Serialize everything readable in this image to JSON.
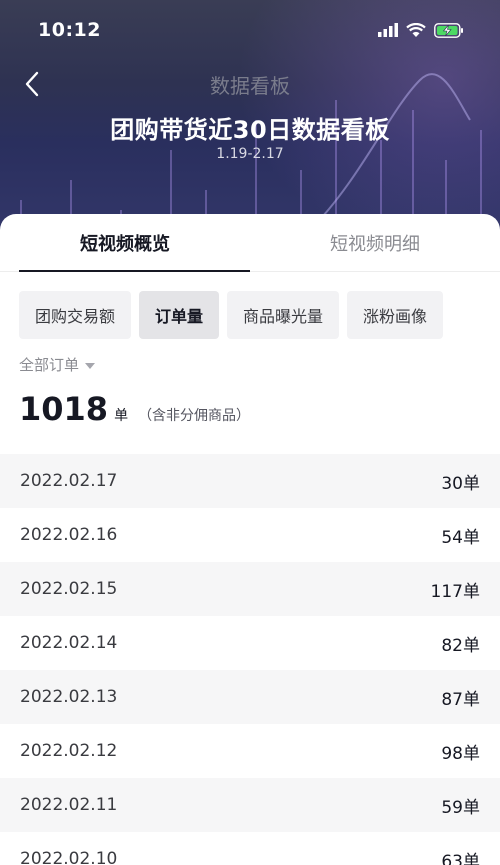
{
  "status_bar": {
    "time": "10:12"
  },
  "nav": {
    "title": "数据看板"
  },
  "hero": {
    "title": "团购带货近30日数据看板",
    "date_range": "1.19-2.17"
  },
  "tabs": [
    {
      "label": "短视频概览",
      "active": true
    },
    {
      "label": "短视频明细",
      "active": false
    }
  ],
  "chips": [
    {
      "label": "团购交易额",
      "active": false
    },
    {
      "label": "订单量",
      "active": true
    },
    {
      "label": "商品曝光量",
      "active": false
    },
    {
      "label": "涨粉画像",
      "active": false
    }
  ],
  "filter": {
    "label": "全部订单"
  },
  "summary": {
    "total": "1018",
    "unit": "单",
    "note": "（含非分佣商品）"
  },
  "rows": [
    {
      "date": "2022.02.17",
      "value": "30单"
    },
    {
      "date": "2022.02.16",
      "value": "54单"
    },
    {
      "date": "2022.02.15",
      "value": "117单"
    },
    {
      "date": "2022.02.14",
      "value": "82单"
    },
    {
      "date": "2022.02.13",
      "value": "87单"
    },
    {
      "date": "2022.02.12",
      "value": "98单"
    },
    {
      "date": "2022.02.11",
      "value": "59单"
    },
    {
      "date": "2022.02.10",
      "value": "63单"
    }
  ],
  "icons": {
    "back": "chevron-left-icon",
    "signal": "signal-icon",
    "wifi": "wifi-icon",
    "battery": "battery-charging-icon",
    "dropdown": "caret-down-icon"
  },
  "colors": {
    "hero_bg": "#2e3252",
    "text_primary": "#161823",
    "text_secondary": "#8a8b91",
    "row_alt": "#f6f6f7"
  }
}
